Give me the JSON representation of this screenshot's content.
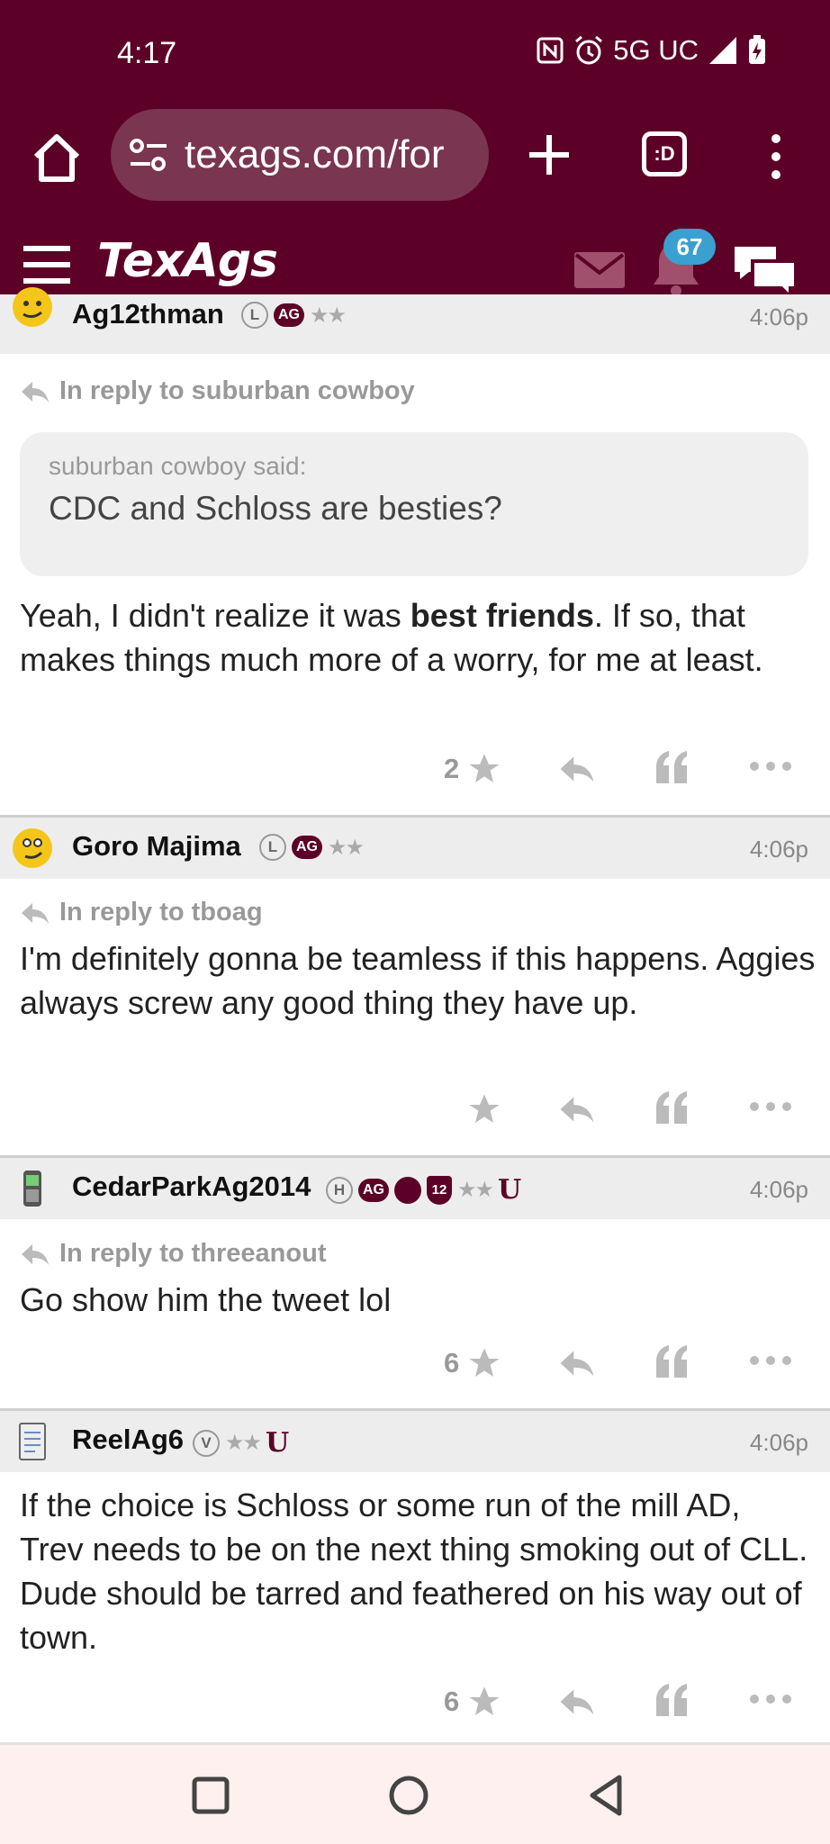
{
  "status_bar": {
    "time": "4:17",
    "network": "5G UC"
  },
  "browser": {
    "url_text": "texags.com/for",
    "tabs_label": ":D"
  },
  "site": {
    "logo": "TexAgs",
    "notification_count": "67"
  },
  "colors": {
    "brand": "#5c0027",
    "badge": "#3aa0d0"
  },
  "posts": [
    {
      "username": "Ag12thman",
      "badges": [
        "L",
        "AG"
      ],
      "time": "4:06p",
      "reply_to": "In reply to suburban cowboy",
      "quote": {
        "said": "suburban cowboy said:",
        "text": "CDC and Schloss are besties?"
      },
      "body_pre": "Yeah, I didn't realize it was ",
      "body_bold": "best friends",
      "body_post": ". If so, that makes things much more of a worry, for me at least.",
      "star_count": "2"
    },
    {
      "username": "Goro Majima",
      "badges": [
        "L",
        "AG"
      ],
      "time": "4:06p",
      "reply_to": "In reply to tboag",
      "body": "I'm definitely gonna be teamless if this happens. Aggies always screw any good thing they have up.",
      "star_count": ""
    },
    {
      "username": "CedarParkAg2014",
      "badges": [
        "H",
        "AG",
        "12"
      ],
      "time": "4:06p",
      "reply_to": "In reply to threeanout",
      "body": "Go show him the tweet lol",
      "star_count": "6"
    },
    {
      "username": "ReelAg6",
      "badges": [
        "V"
      ],
      "time": "4:06p",
      "body": "If the choice is Schloss or some run of the mill AD, Trev needs to be on the next thing smoking out of CLL. Dude should be tarred and feathered on his way out of town.",
      "star_count": "6"
    }
  ],
  "icons": [
    "home-icon",
    "tune-icon",
    "plus-icon",
    "tabs-icon",
    "more-vert-icon",
    "hamburger-icon",
    "mail-icon",
    "bell-icon",
    "chat-icon",
    "star-icon",
    "reply-icon",
    "quote-icon",
    "more-horiz-icon",
    "square-icon",
    "circle-icon",
    "back-triangle-icon"
  ]
}
